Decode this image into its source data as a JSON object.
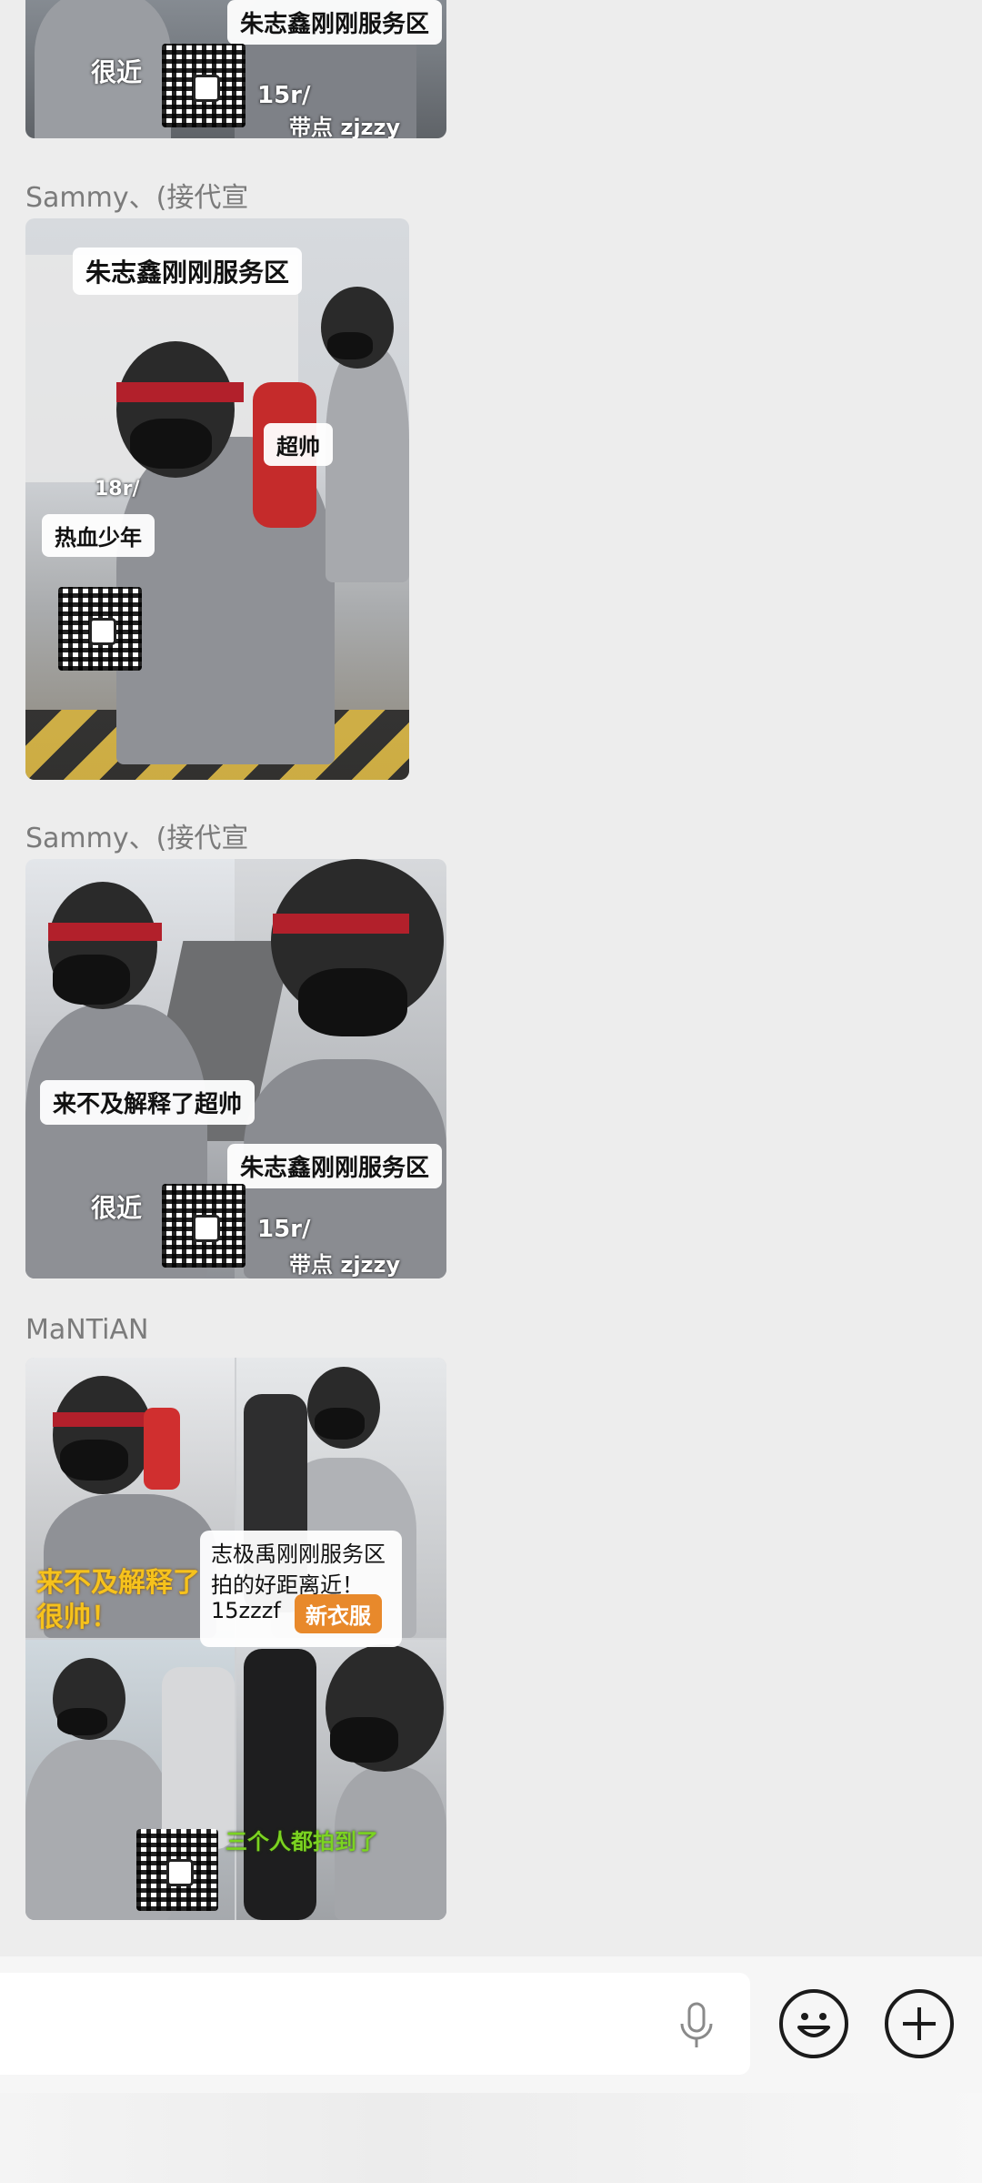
{
  "messages": [
    {
      "sender": "",
      "captions": [
        "朱志鑫刚刚服务区",
        "很近",
        "15r/",
        "带点 zjzzy"
      ]
    },
    {
      "sender": "Sammy、(接代宣",
      "captions": [
        "朱志鑫刚刚服务区",
        "超帅",
        "18r/",
        "热血少年"
      ]
    },
    {
      "sender": "Sammy、(接代宣",
      "captions": [
        "来不及解释了超帅",
        "朱志鑫刚刚服务区",
        "很近",
        "15r/",
        "带点 zjzzy"
      ]
    },
    {
      "sender": "MaNTiAN",
      "captions": [
        "来不及解释了",
        "很帅！",
        "志极禹刚刚服务区",
        "拍的好距离近！",
        "15zzzf",
        "新衣服",
        "三个人都拍到了"
      ]
    }
  ],
  "input_bar": {
    "value": "",
    "voice_icon": "microphone-icon",
    "emoji_icon": "smiley-face-icon",
    "more_icon": "plus-circle-icon"
  },
  "colors": {
    "background": "#ededed",
    "sender_text": "#7b7b7b",
    "orange_label": "#e8892b",
    "yellow_text": "#f6c21c",
    "green_text": "#7bd321"
  }
}
